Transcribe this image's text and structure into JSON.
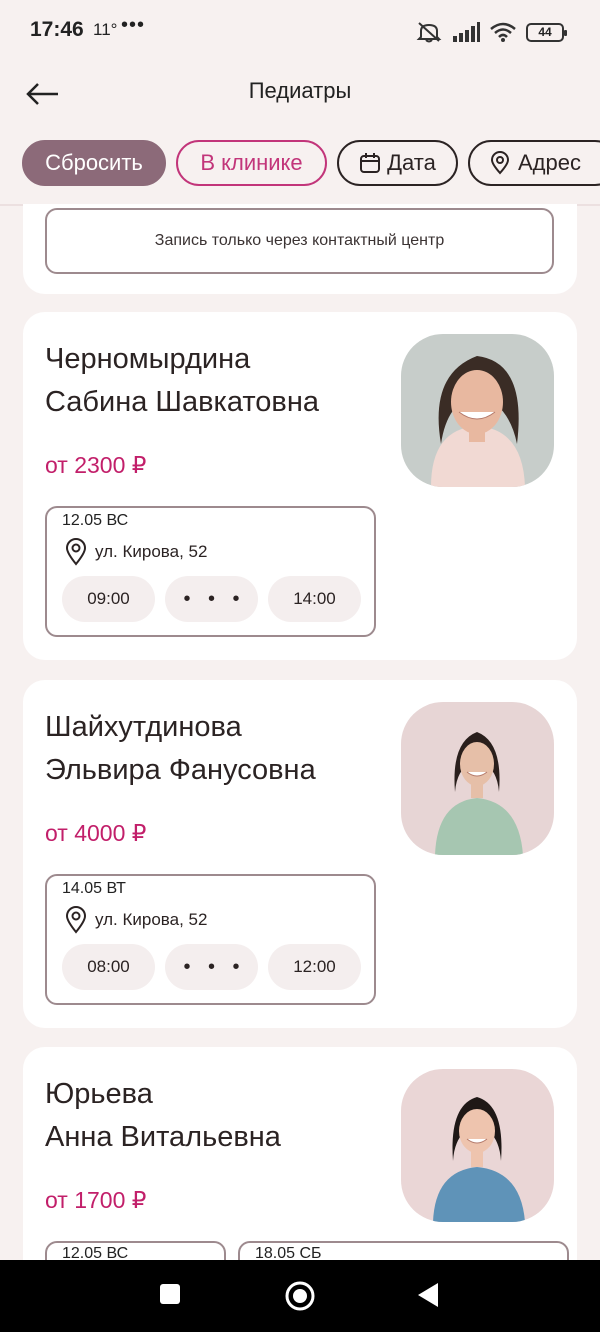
{
  "status_bar": {
    "time": "17:46",
    "temperature": "11°",
    "more": "•••",
    "battery": "44"
  },
  "header": {
    "title": "Педиатры"
  },
  "filters": [
    {
      "label": "Сбросить"
    },
    {
      "label": "В клинике"
    },
    {
      "label": "Дата",
      "icon": "calendar-icon"
    },
    {
      "label": "Адрес",
      "icon": "location-pin-icon"
    }
  ],
  "previous_card": {
    "note": "Запись только через контактный центр"
  },
  "doctors": [
    {
      "name_line1": "Черномырдина",
      "name_line2": "Сабина Шавкатовна",
      "price": "от 2300 ₽",
      "slot": {
        "date": "12.05 ВС",
        "address": "ул. Кирова, 52",
        "times": [
          "09:00",
          "• • •",
          "14:00"
        ]
      }
    },
    {
      "name_line1": "Шайхутдинова",
      "name_line2": "Эльвира Фанусовна",
      "price": "от 4000 ₽",
      "slot": {
        "date": "14.05 ВТ",
        "address": "ул. Кирова, 52",
        "times": [
          "08:00",
          "• • •",
          "12:00"
        ]
      }
    },
    {
      "name_line1": "Юрьева",
      "name_line2": "Анна Витальевна",
      "price": "от 1700 ₽",
      "slots": [
        {
          "date": "12.05 ВС"
        },
        {
          "date": "18.05 СБ"
        }
      ]
    }
  ],
  "colors": {
    "accent": "#c21f6a",
    "reset_chip": "#8c6a79",
    "background": "#f7f1f0",
    "card": "#ffffff"
  }
}
